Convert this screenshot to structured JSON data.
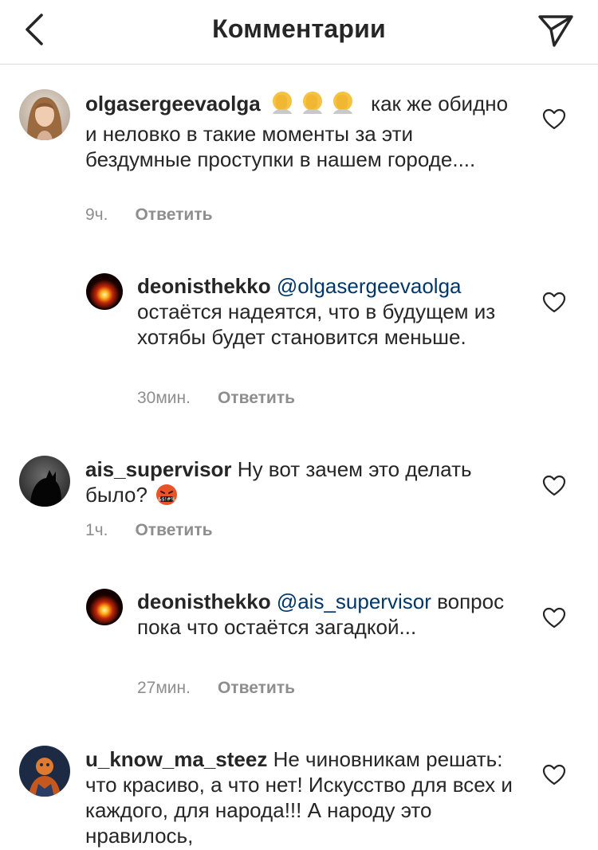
{
  "header": {
    "title": "Комментарии",
    "back_icon": "chevron-left-icon",
    "share_icon": "paper-plane-icon"
  },
  "comments": [
    {
      "username": "olgasergeevaolga",
      "emoji": "🤦🤦🤦",
      "text": "как же обидно и неловко в такие моменты за эти бездумные проступки в нашем городе....",
      "time": "9ч.",
      "reply_label": "Ответить",
      "avatar_icon": "user-avatar-photo"
    },
    {
      "username": "deonisthekko",
      "mention": "@olgasergeevaolga",
      "text": "остаётся надеятся, что в будущем из хотябы будет становится меньше.",
      "time": "30мин.",
      "reply_label": "Ответить",
      "avatar_icon": "glowing-orb-avatar"
    },
    {
      "username": "ais_supervisor",
      "text": "Ну вот зачем это делать было?",
      "emoji": "🤬",
      "time": "1ч.",
      "reply_label": "Ответить",
      "avatar_icon": "dark-cat-avatar"
    },
    {
      "username": "deonisthekko",
      "mention": "@ais_supervisor",
      "text": "вопрос пока что остаётся загадкой...",
      "time": "27мин.",
      "reply_label": "Ответить",
      "avatar_icon": "glowing-orb-avatar"
    },
    {
      "username": "u_know_ma_steez",
      "text": "Не чиновникам решать: что красиво, а что нет! Искусство для всех и каждого, для народа!!! А народу это нравилось,",
      "avatar_icon": "illustrated-avatar"
    }
  ],
  "colors": {
    "text": "#262626",
    "meta": "#8e8e8e",
    "mention": "#00376b",
    "divider": "#dbdbdb"
  }
}
